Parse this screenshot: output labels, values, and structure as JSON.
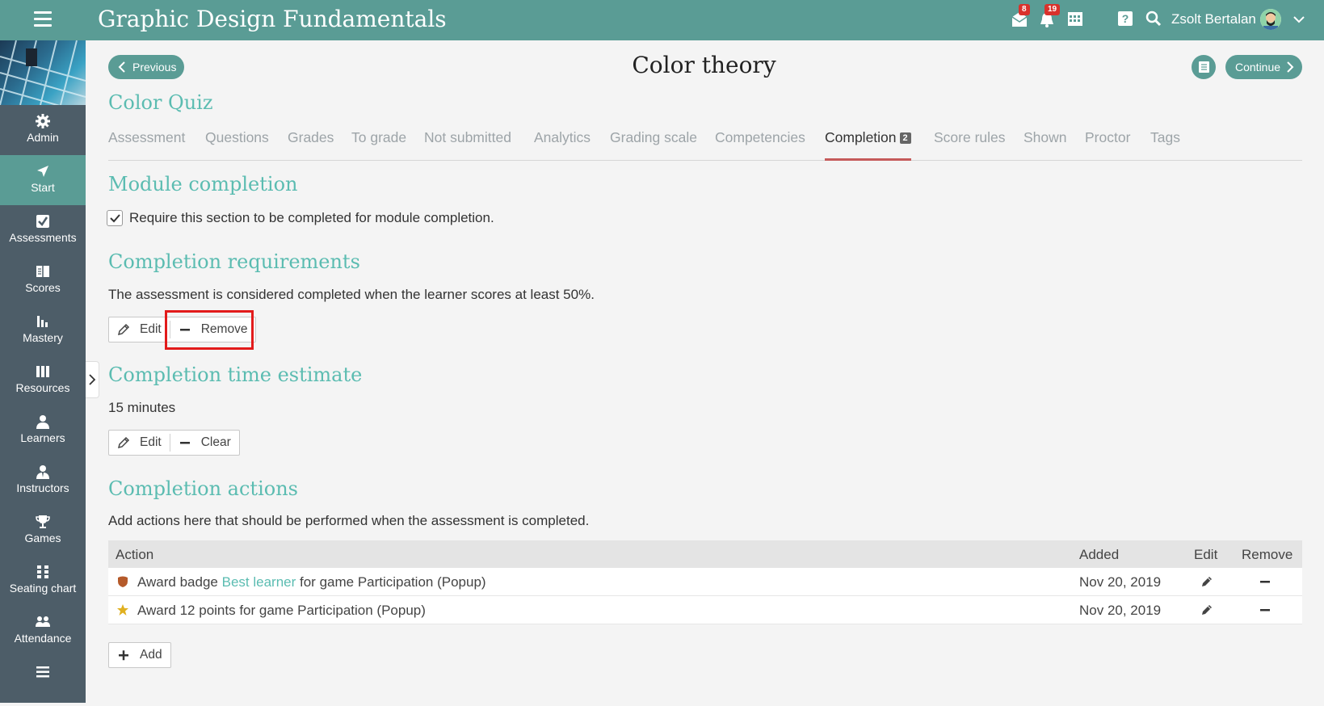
{
  "header": {
    "title": "Graphic Design Fundamentals",
    "messages_badge": "8",
    "notifications_badge": "19",
    "user_name": "Zsolt Bertalan"
  },
  "sidebar": {
    "items": [
      {
        "label": "Admin",
        "icon": "gear-icon"
      },
      {
        "label": "Start",
        "icon": "start-arrow-icon"
      },
      {
        "label": "Assessments",
        "icon": "assessments-check-icon"
      },
      {
        "label": "Scores",
        "icon": "scores-icon"
      },
      {
        "label": "Mastery",
        "icon": "mastery-chart-icon"
      },
      {
        "label": "Resources",
        "icon": "resources-books-icon"
      },
      {
        "label": "Learners",
        "icon": "learner-person-icon"
      },
      {
        "label": "Instructors",
        "icon": "instructor-person-icon"
      },
      {
        "label": "Games",
        "icon": "trophy-icon"
      },
      {
        "label": "Seating chart",
        "icon": "seating-chart-icon"
      },
      {
        "label": "Attendance",
        "icon": "attendance-group-icon"
      },
      {
        "label": "",
        "icon": "list-icon"
      }
    ]
  },
  "nav": {
    "previous_label": "Previous",
    "continue_label": "Continue",
    "page_title": "Color theory"
  },
  "quiz_title": "Color Quiz",
  "tabs": [
    {
      "label": "Assessment"
    },
    {
      "label": "Questions"
    },
    {
      "label": "Grades"
    },
    {
      "label": "To grade"
    },
    {
      "label": "Not submitted"
    },
    {
      "label": "Analytics"
    },
    {
      "label": "Grading scale"
    },
    {
      "label": "Competencies"
    },
    {
      "label": "Completion",
      "badge": "2",
      "active": true
    },
    {
      "label": "Score rules"
    },
    {
      "label": "Shown"
    },
    {
      "label": "Proctor"
    },
    {
      "label": "Tags"
    }
  ],
  "module_completion": {
    "heading": "Module completion",
    "checkbox_label": "Require this section to be completed for module completion.",
    "checked": true
  },
  "requirements": {
    "heading": "Completion requirements",
    "text": "The assessment is considered completed when the learner scores at least 50%.",
    "edit_label": "Edit",
    "remove_label": "Remove"
  },
  "time_estimate": {
    "heading": "Completion time estimate",
    "value": "15 minutes",
    "edit_label": "Edit",
    "clear_label": "Clear"
  },
  "actions": {
    "heading": "Completion actions",
    "text": "Add actions here that should be performed when the assessment is completed.",
    "columns": {
      "action": "Action",
      "added": "Added",
      "edit": "Edit",
      "remove": "Remove"
    },
    "rows": [
      {
        "icon": "badge-shield-icon",
        "prefix": "Award badge ",
        "link": "Best learner",
        "suffix": " for game Participation (Popup)",
        "added": "Nov 20, 2019"
      },
      {
        "icon": "star-icon",
        "prefix": "Award 12 points for game Participation (Popup)",
        "link": "",
        "suffix": "",
        "added": "Nov 20, 2019"
      }
    ],
    "add_label": "Add"
  },
  "colors": {
    "topbar": "#5a9c95",
    "sidebar": "#4d5d68",
    "accent": "#5bbcb1",
    "active_tab_underline": "#c55a5a",
    "highlight_box": "#e21b1b"
  }
}
